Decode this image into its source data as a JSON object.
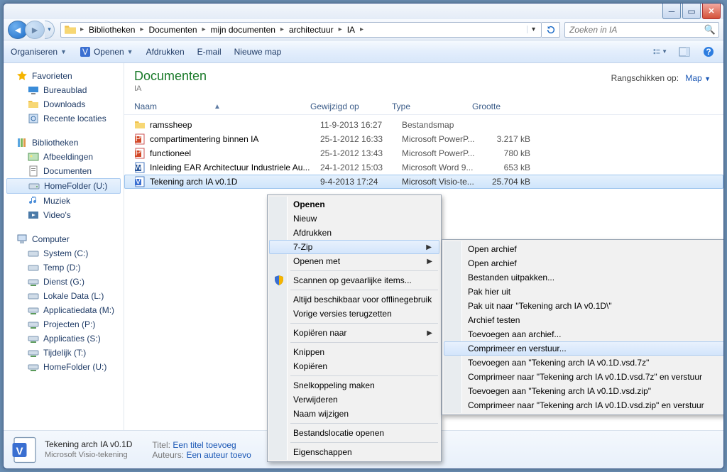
{
  "window": {
    "min_tooltip": "Minimize",
    "max_tooltip": "Maximize",
    "close_tooltip": "Close"
  },
  "breadcrumb": [
    "Bibliotheken",
    "Documenten",
    "mijn documenten",
    "architectuur",
    "IA"
  ],
  "search": {
    "placeholder": "Zoeken in IA"
  },
  "toolbar": {
    "organize": "Organiseren",
    "open": "Openen",
    "print": "Afdrukken",
    "email": "E-mail",
    "new_folder": "Nieuwe map"
  },
  "sidebar": {
    "favorites": {
      "label": "Favorieten",
      "items": [
        "Bureaublad",
        "Downloads",
        "Recente locaties"
      ]
    },
    "libraries": {
      "label": "Bibliotheken",
      "items": [
        "Afbeeldingen",
        "Documenten",
        "HomeFolder (U:)",
        "Muziek",
        "Video's"
      ]
    },
    "computer": {
      "label": "Computer",
      "items": [
        "System (C:)",
        "Temp (D:)",
        "Dienst (G:)",
        "Lokale Data (L:)",
        "Applicatiedata (M:)",
        "Projecten (P:)",
        "Applicaties (S:)",
        "Tijdelijk (T:)",
        "HomeFolder (U:)"
      ]
    }
  },
  "content": {
    "title": "Documenten",
    "subtitle": "IA",
    "arrange_label": "Rangschikken op:",
    "arrange_value": "Map",
    "columns": {
      "name": "Naam",
      "modified": "Gewijzigd op",
      "type": "Type",
      "size": "Grootte"
    },
    "rows": [
      {
        "icon": "folder",
        "name": "ramssheep",
        "modified": "11-9-2013 16:27",
        "type": "Bestandsmap",
        "size": ""
      },
      {
        "icon": "ppt",
        "name": "compartimentering binnen IA",
        "modified": "25-1-2012 16:33",
        "type": "Microsoft PowerP...",
        "size": "3.217 kB"
      },
      {
        "icon": "ppt",
        "name": "functioneel",
        "modified": "25-1-2012 13:43",
        "type": "Microsoft PowerP...",
        "size": "780 kB"
      },
      {
        "icon": "word",
        "name": "Inleiding EAR Architectuur Industriele Au...",
        "modified": "24-1-2012 15:03",
        "type": "Microsoft Word 9...",
        "size": "653 kB"
      },
      {
        "icon": "visio",
        "name": "Tekening arch IA v0.1D",
        "modified": "9-4-2013 17:24",
        "type": "Microsoft Visio-te...",
        "size": "25.704 kB",
        "selected": true
      }
    ]
  },
  "details": {
    "name": "Tekening arch IA v0.1D",
    "sub": "Microsoft Visio-tekening",
    "title_label": "Titel:",
    "title_value": "Een titel toevoeg",
    "authors_label": "Auteurs:",
    "authors_value": "Een auteur toevo"
  },
  "context_menu_1": {
    "items": [
      {
        "label": "Openen",
        "bold": true
      },
      {
        "label": "Nieuw"
      },
      {
        "label": "Afdrukken"
      },
      {
        "label": "7-Zip",
        "submenu": true,
        "hover": true
      },
      {
        "label": "Openen met",
        "submenu": true
      },
      {
        "sep": true
      },
      {
        "label": "Scannen op gevaarlijke items...",
        "shield": true
      },
      {
        "sep": true
      },
      {
        "label": "Altijd beschikbaar voor offlinegebruik"
      },
      {
        "label": "Vorige versies terugzetten"
      },
      {
        "sep": true
      },
      {
        "label": "Kopiëren naar",
        "submenu": true
      },
      {
        "sep": true
      },
      {
        "label": "Knippen"
      },
      {
        "label": "Kopiëren"
      },
      {
        "sep": true
      },
      {
        "label": "Snelkoppeling maken"
      },
      {
        "label": "Verwijderen"
      },
      {
        "label": "Naam wijzigen"
      },
      {
        "sep": true
      },
      {
        "label": "Bestandslocatie openen"
      },
      {
        "sep": true
      },
      {
        "label": "Eigenschappen"
      }
    ]
  },
  "context_menu_2": {
    "items": [
      {
        "label": "Open archief"
      },
      {
        "label": "Open archief",
        "submenu": true
      },
      {
        "label": "Bestanden uitpakken..."
      },
      {
        "label": "Pak hier uit"
      },
      {
        "label": "Pak uit naar \"Tekening arch IA v0.1D\\\""
      },
      {
        "label": "Archief testen"
      },
      {
        "label": "Toevoegen aan archief..."
      },
      {
        "label": "Comprimeer en verstuur...",
        "hover": true
      },
      {
        "label": "Toevoegen aan \"Tekening arch IA v0.1D.vsd.7z\""
      },
      {
        "label": "Comprimeer naar \"Tekening arch IA v0.1D.vsd.7z\" en verstuur"
      },
      {
        "label": "Toevoegen aan \"Tekening arch IA v0.1D.vsd.zip\""
      },
      {
        "label": "Comprimeer naar \"Tekening arch IA v0.1D.vsd.zip\" en verstuur"
      }
    ]
  }
}
